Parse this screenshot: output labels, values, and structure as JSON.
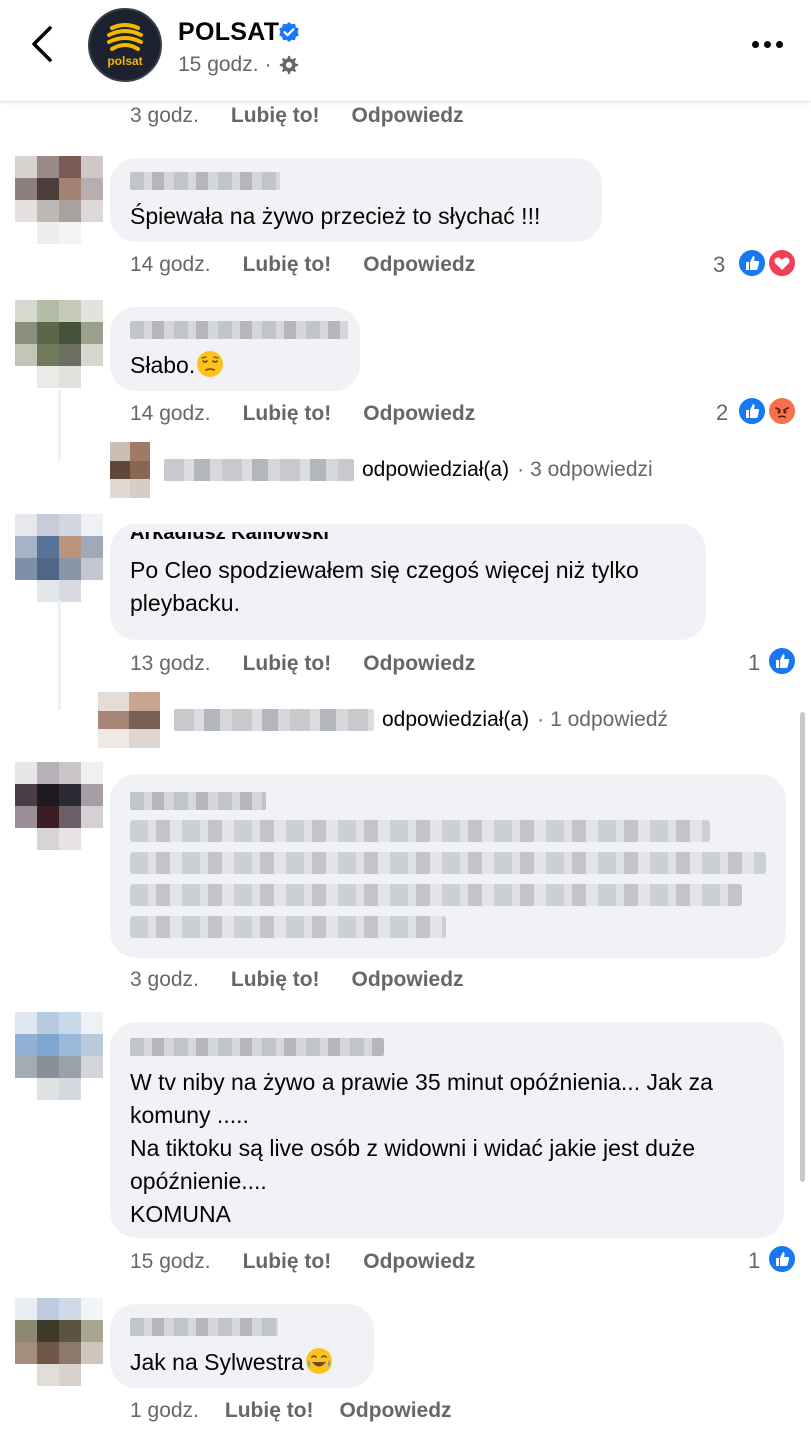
{
  "header": {
    "page_name": "POLSAT",
    "logo_text": "polsat",
    "time": "15 godz.",
    "separator": "·"
  },
  "labels": {
    "like": "Lubię to!",
    "reply": "Odpowiedz"
  },
  "top_actions": {
    "time": "3 godz."
  },
  "comments": [
    {
      "time": "14 godz.",
      "text": "Śpiewała na żywo przecież to słychać !!!",
      "reaction_count": "3"
    },
    {
      "time": "14 godz.",
      "text": "Słabo.",
      "reaction_count": "2"
    },
    {
      "author": "Arkadiusz Kaliłowski",
      "time": "13 godz.",
      "text": "Po Cleo spodziewałem się czegoś więcej niż tylko\npleybacku.",
      "reaction_count": "1"
    },
    {
      "time": "3 godz.",
      "text": ""
    },
    {
      "time": "15 godz.",
      "text": "W tv niby na żywo a prawie 35 minut opóźnienia... Jak za\nkomuny .....\nNa tiktoku są live osób z widowni i widać jakie jest duże\nopóźnienie....\nKOMUNA",
      "reaction_count": "1"
    },
    {
      "time": "1 godz.",
      "text": "Jak na Sylwestra"
    }
  ],
  "reply_summaries": [
    {
      "action": "odpowiedział(a)",
      "dot": "·",
      "count": "3 odpowiedzi"
    },
    {
      "action": "odpowiedział(a)",
      "dot": "·",
      "count": "1 odpowiedź"
    }
  ],
  "colors": {
    "like_blue": "#1877f2",
    "love_red": "#f33e58",
    "angry_orange": "#f7714c",
    "bubble_bg": "#f0f2f5",
    "meta_gray": "#65676b"
  },
  "icons": {
    "back": "chevron-left-icon",
    "verified": "verified-badge-icon",
    "settings": "gear-icon",
    "more": "more-dots-icon"
  }
}
